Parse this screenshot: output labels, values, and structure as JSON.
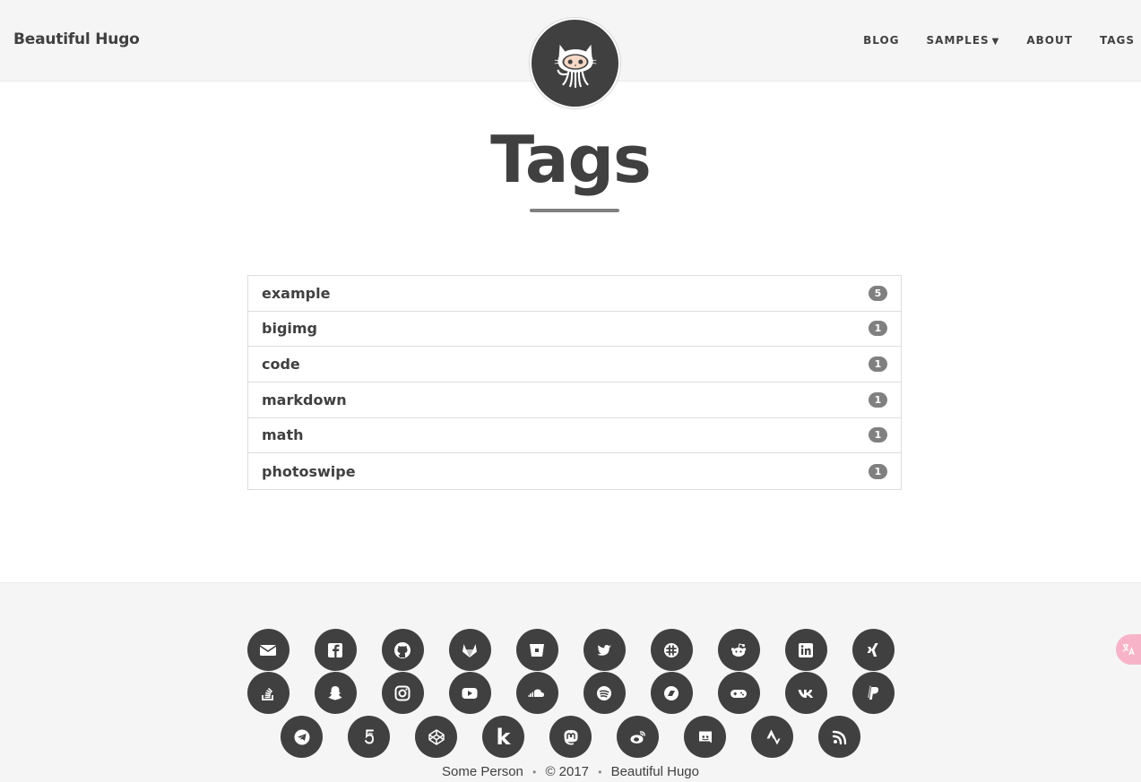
{
  "navbar": {
    "brand": "Beautiful Hugo",
    "links": [
      {
        "label": "BLOG"
      },
      {
        "label": "SAMPLES",
        "caret": "▼"
      },
      {
        "label": "ABOUT"
      },
      {
        "label": "TAGS"
      }
    ]
  },
  "page": {
    "title": "Tags"
  },
  "tags": [
    {
      "name": "example",
      "count": "5"
    },
    {
      "name": "bigimg",
      "count": "1"
    },
    {
      "name": "code",
      "count": "1"
    },
    {
      "name": "markdown",
      "count": "1"
    },
    {
      "name": "math",
      "count": "1"
    },
    {
      "name": "photoswipe",
      "count": "1"
    }
  ],
  "footer": {
    "social_row1": [
      "email-icon",
      "facebook-icon",
      "github-icon",
      "gitlab-icon",
      "bitbucket-icon",
      "twitter-icon",
      "slack-icon",
      "reddit-icon",
      "linkedin-icon",
      "xing-icon"
    ],
    "social_row2": [
      "stackoverflow-icon",
      "snapchat-icon",
      "instagram-icon",
      "youtube-icon",
      "soundcloud-icon",
      "spotify-icon",
      "bandcamp-icon",
      "itch-io-icon",
      "vk-icon",
      "paypal-icon"
    ],
    "social_row3": [
      "telegram-icon",
      "500px-icon",
      "codepen-icon",
      "kaggle-icon",
      "mastodon-icon",
      "weibo-icon",
      "discord-icon",
      "strava-icon",
      "rss-icon"
    ],
    "kaggle_letter": "k",
    "author": "Some Person",
    "year": "© 2017",
    "theme": "Beautiful Hugo",
    "separator": "•"
  },
  "colors": {
    "text": "#404040",
    "navbar_bg": "#f5f5f5",
    "badge_bg": "#808080",
    "translate_tab": "#f7b4c9"
  }
}
